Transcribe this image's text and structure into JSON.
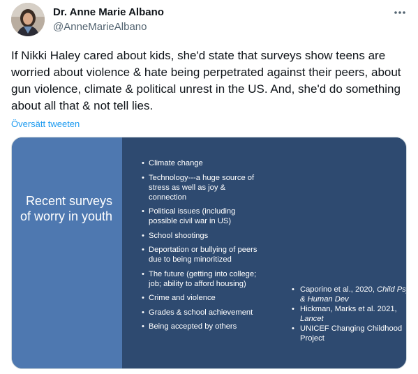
{
  "author": {
    "name": "Dr. Anne Marie Albano",
    "handle": "@AnneMarieAlbano"
  },
  "tweet": {
    "text": "If Nikki Haley cared about kids, she'd state that surveys show teens are worried about violence & hate being perpetrated against their peers, about gun violence, climate & political unrest in the US. And, she'd do something about all that & not tell lies.",
    "translate_label": "Översätt tweeten"
  },
  "slide": {
    "title": "Recent surveys of worry in youth",
    "bullets": [
      "Climate change",
      "Technology---a huge source of stress as well as joy & connection",
      "Political issues (including possible civil war in US)",
      "School shootings",
      "Deportation or bullying of peers due to being minoritized",
      "The future (getting into college; job; ability to afford housing)",
      "Crime and violence",
      "Grades & school achievement",
      "Being accepted by others"
    ],
    "references": [
      {
        "plain": "Caporino et al., 2020, ",
        "italic": "Child Psy & Human Dev"
      },
      {
        "plain": "Hickman, Marks et al. 2021, ",
        "italic": "Lancet"
      },
      {
        "plain": "UNICEF Changing Childhood Project",
        "italic": ""
      }
    ]
  },
  "icons": {
    "more": "more-horizontal-icon"
  },
  "colors": {
    "link": "#1d9bf0",
    "slide_left": "#4e78b0",
    "slide_right": "#2e4a70"
  }
}
